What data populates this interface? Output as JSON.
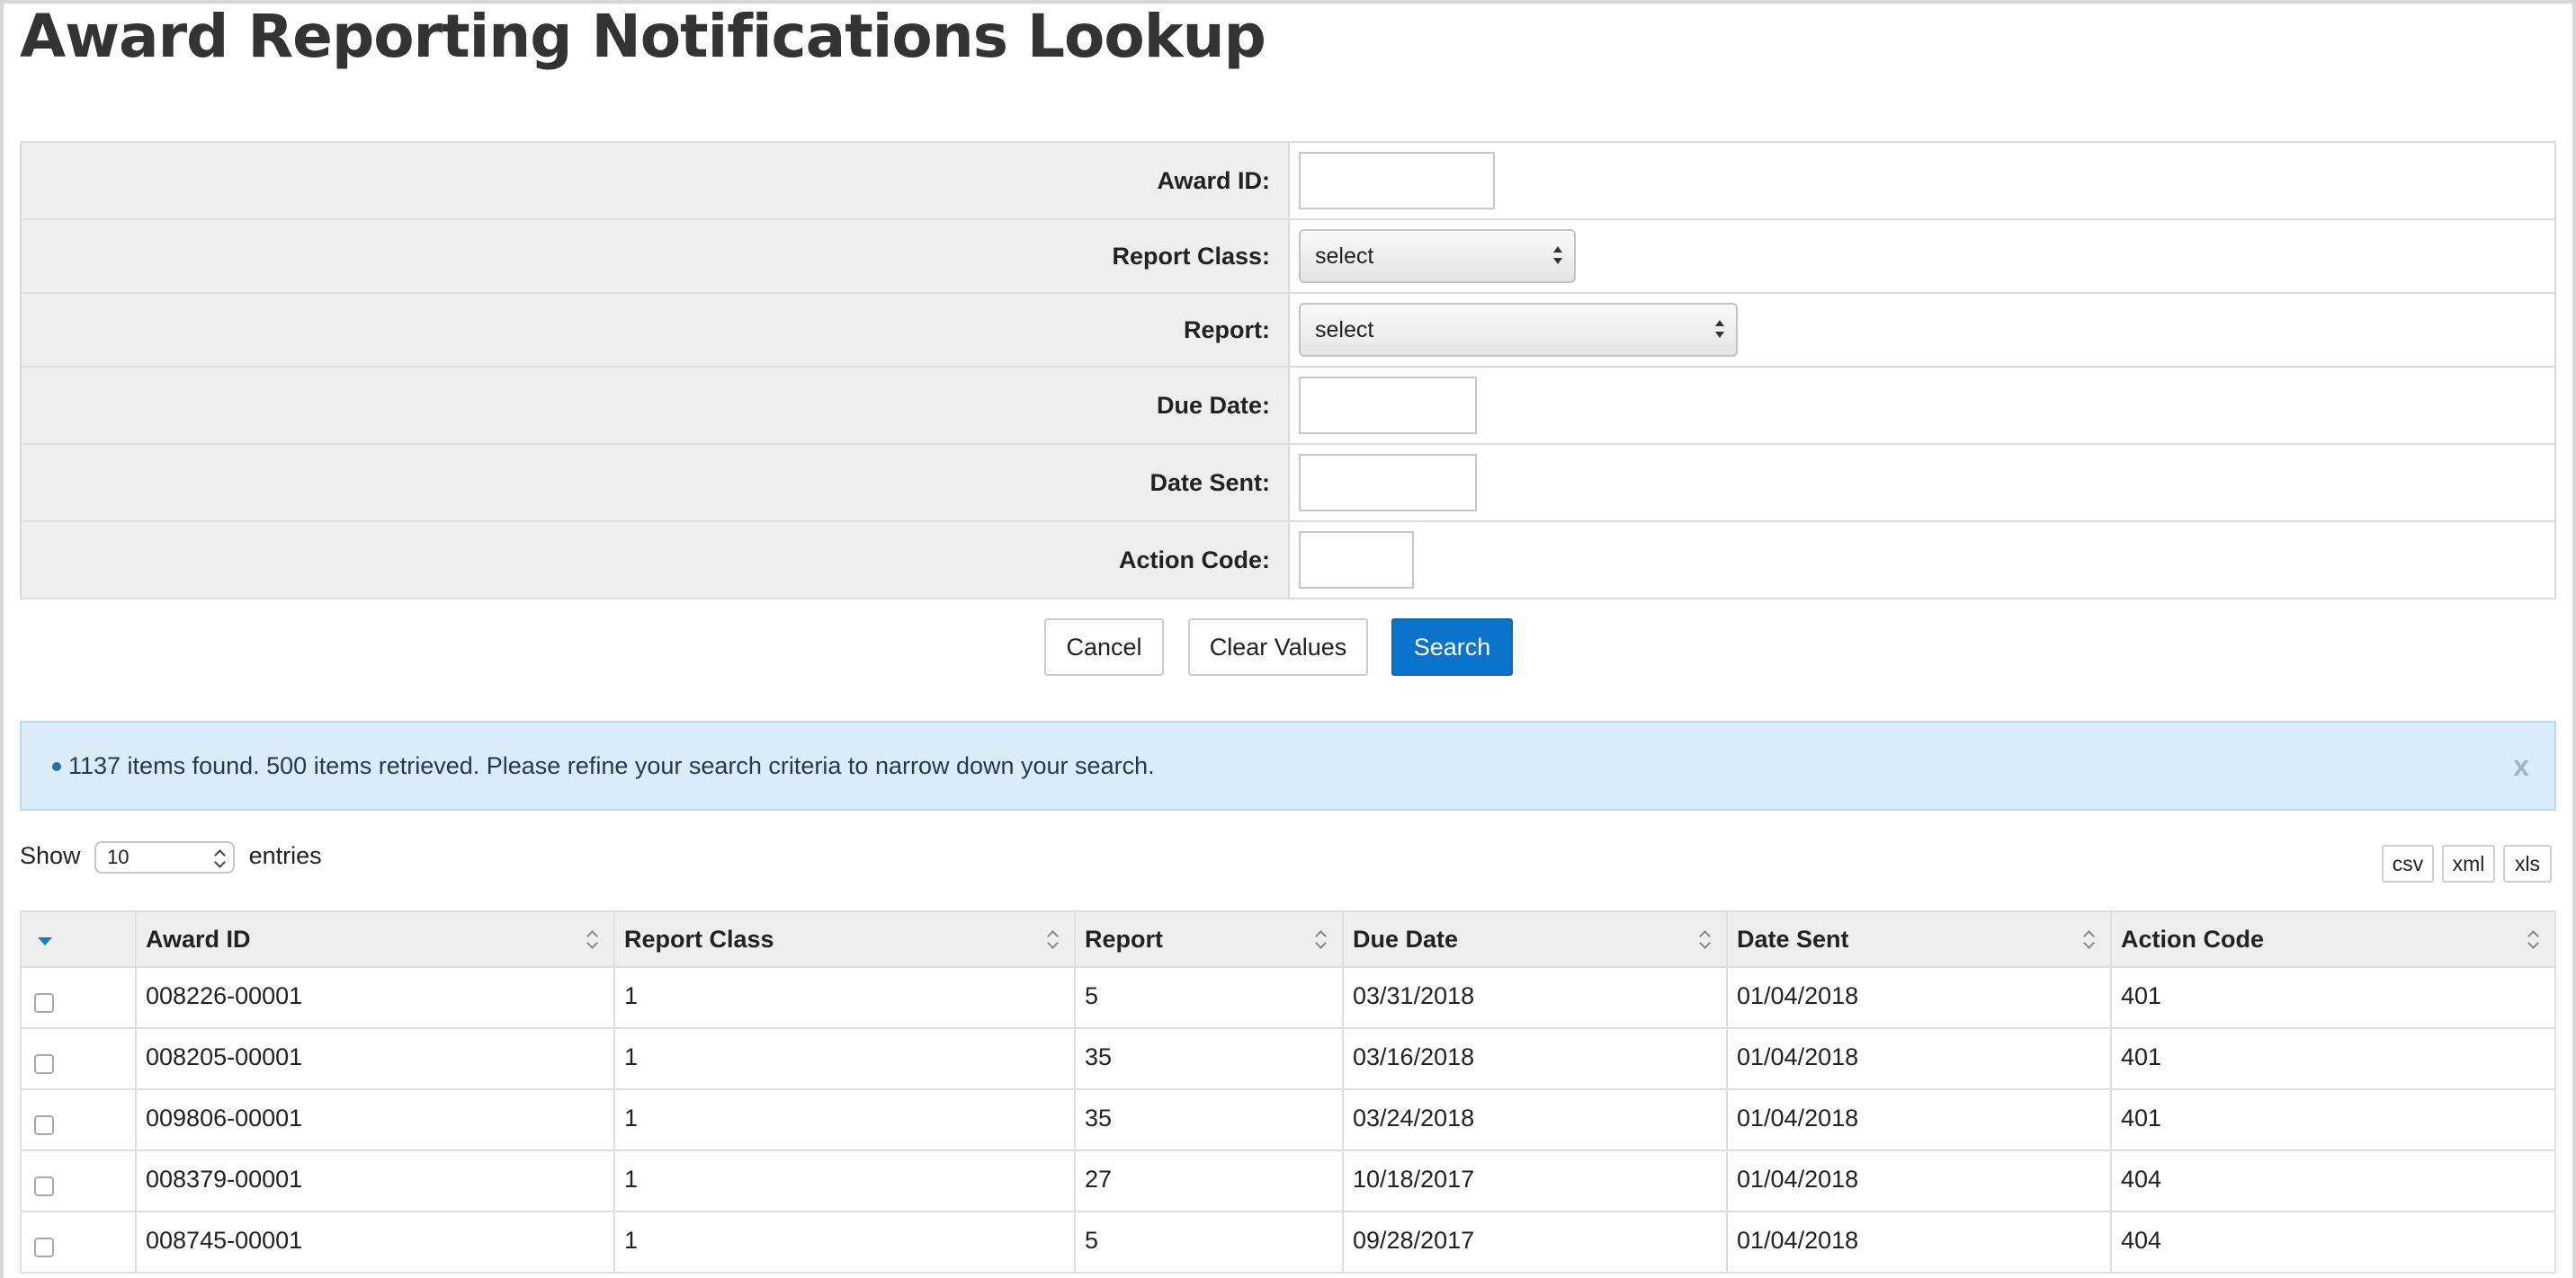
{
  "page": {
    "title": "Award Reporting Notifications Lookup"
  },
  "form": {
    "award_id": {
      "label": "Award ID:",
      "value": ""
    },
    "report_class": {
      "label": "Report Class:",
      "value": "select"
    },
    "report": {
      "label": "Report:",
      "value": "select"
    },
    "due_date": {
      "label": "Due Date:",
      "value": ""
    },
    "date_sent": {
      "label": "Date Sent:",
      "value": ""
    },
    "action_code": {
      "label": "Action Code:",
      "value": ""
    }
  },
  "buttons": {
    "cancel": "Cancel",
    "clear": "Clear Values",
    "search": "Search"
  },
  "info": {
    "message": "1137 items found. 500 items retrieved. Please refine your search criteria to narrow down your search.",
    "close": "x"
  },
  "length": {
    "show": "Show",
    "value": "10",
    "entries": "entries"
  },
  "export": {
    "csv": "csv",
    "xml": "xml",
    "xls": "xls"
  },
  "table": {
    "headers": [
      "Award ID",
      "Report Class",
      "Report",
      "Due Date",
      "Date Sent",
      "Action Code"
    ],
    "rows": [
      [
        "008226-00001",
        "1",
        "5",
        "03/31/2018",
        "01/04/2018",
        "401"
      ],
      [
        "008205-00001",
        "1",
        "35",
        "03/16/2018",
        "01/04/2018",
        "401"
      ],
      [
        "009806-00001",
        "1",
        "35",
        "03/24/2018",
        "01/04/2018",
        "401"
      ],
      [
        "008379-00001",
        "1",
        "27",
        "10/18/2017",
        "01/04/2018",
        "404"
      ],
      [
        "008745-00001",
        "1",
        "5",
        "09/28/2017",
        "01/04/2018",
        "404"
      ]
    ]
  },
  "colors": {
    "primary": "#0a74cc",
    "info_bg": "#d9ecf7",
    "label_bg": "#eeeeee"
  }
}
